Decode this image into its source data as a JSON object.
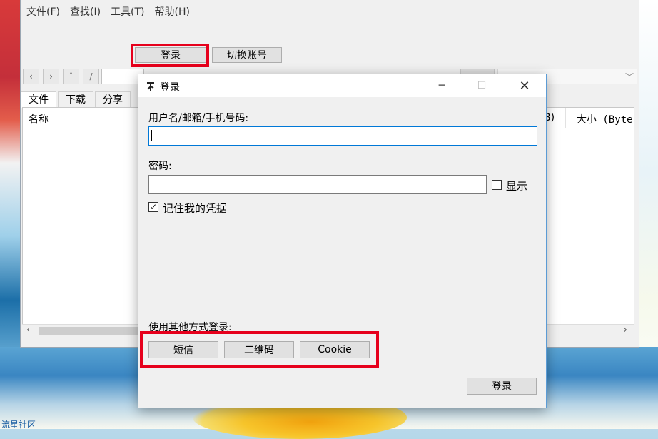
{
  "main": {
    "menu": [
      "文件(F)",
      "查找(I)",
      "工具(T)",
      "帮助(H)"
    ],
    "login_button": "登录",
    "switch_account_button": "切换账号",
    "nav": {
      "back": "‹",
      "forward": "›",
      "up": "˄",
      "root": "/"
    },
    "tabs": [
      "文件",
      "下载",
      "分享"
    ],
    "columns": {
      "name": "名称",
      "partial": "B)",
      "size": "大小 (Byte"
    }
  },
  "dialog": {
    "title": "登录",
    "username_label": "用户名/邮箱/手机号码:",
    "username_value": "",
    "password_label": "密码:",
    "password_value": "",
    "show_label": "显示",
    "show_checked": false,
    "remember_label": "记住我的凭据",
    "remember_checked": true,
    "other_methods_label": "使用其他方式登录:",
    "methods": [
      "短信",
      "二维码",
      "Cookie"
    ],
    "submit_label": "登录"
  },
  "watermark": "流星社区",
  "colors": {
    "highlight_red": "#e6001c",
    "dialog_border": "#5b9bd5",
    "focus_border": "#0078d7"
  },
  "icons": [
    "app-icon",
    "minimize-icon",
    "maximize-icon",
    "close-icon",
    "checkmark-icon"
  ]
}
